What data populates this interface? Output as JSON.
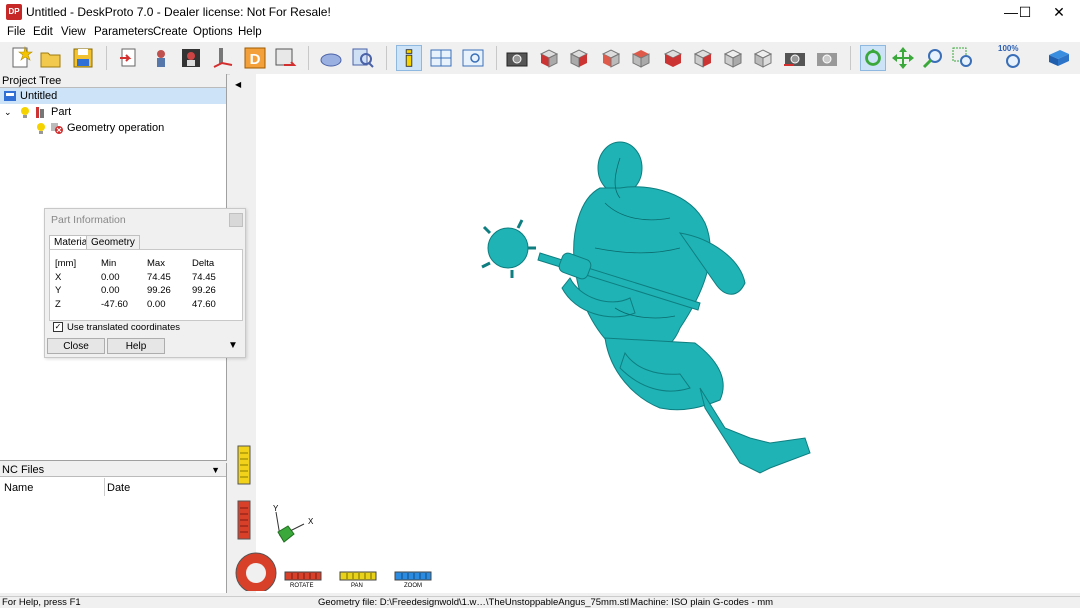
{
  "window": {
    "title": "Untitled - DeskProto 7.0 - Dealer license: Not For Resale!",
    "logo_text": "DP",
    "controls": {
      "minimize": "—",
      "maximize": "☐",
      "close": "✕"
    }
  },
  "menu": [
    "File",
    "Edit",
    "View",
    "Parameters",
    "Create",
    "Options",
    "Help"
  ],
  "toolbar": {
    "zoom_label": "100%"
  },
  "project_tree": {
    "header": "Project Tree",
    "items": [
      {
        "label": "Untitled",
        "icon": "project-icon"
      },
      {
        "label": "Part",
        "icon": "part-icon"
      },
      {
        "label": "Geometry operation",
        "icon": "geometry-operation-icon"
      }
    ]
  },
  "nc_files": {
    "header": "NC Files",
    "columns": [
      "Name",
      "Date"
    ]
  },
  "part_information": {
    "title": "Part Information",
    "tabs": [
      "Material",
      "Geometry"
    ],
    "header": [
      "[mm]",
      "Min",
      "Max",
      "Delta"
    ],
    "rows": [
      {
        "axis": "X",
        "min": "0.00",
        "max": "74.45",
        "delta": "74.45"
      },
      {
        "axis": "Y",
        "min": "0.00",
        "max": "99.26",
        "delta": "99.26"
      },
      {
        "axis": "Z",
        "min": "-47.60",
        "max": "0.00",
        "delta": "47.60"
      }
    ],
    "checkbox_label": "Use translated coordinates",
    "checkbox_checked": true,
    "close_label": "Close",
    "help_label": "Help"
  },
  "view_controls": {
    "rotate": "ROTATE",
    "pan": "PAN",
    "zoom": "ZOOM"
  },
  "axes": {
    "y": "Y",
    "x": "X"
  },
  "status": {
    "help": "For Help, press F1",
    "geometry": "Geometry file: D:\\Freedesignwold\\1.w…\\TheUnstoppableAngus_75mm.stl",
    "machine": "Machine: ISO plain G-codes - mm"
  },
  "colors": {
    "model": "#1fb3b5",
    "selection": "#cde3f7",
    "rotate": "#d8402a",
    "pan": "#e8d21a",
    "zoom": "#2a8be0"
  }
}
